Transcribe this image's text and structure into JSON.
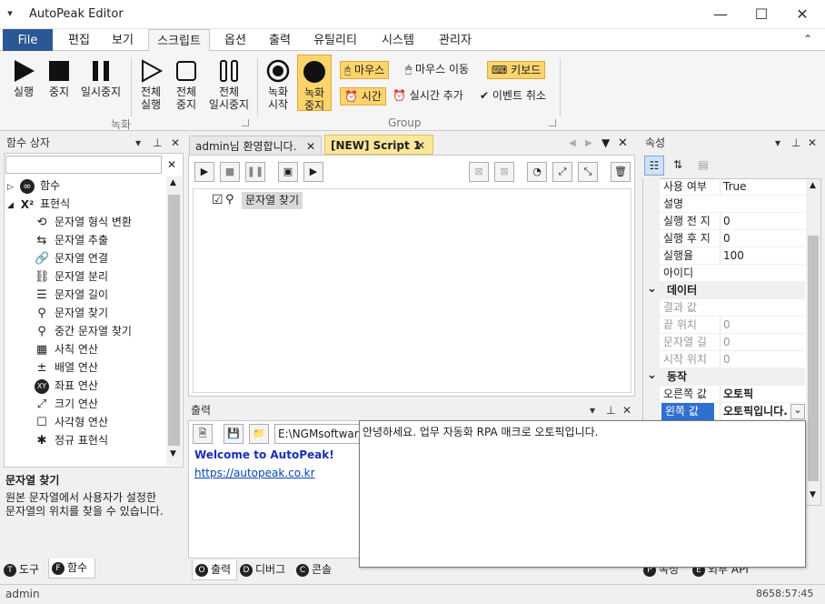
{
  "window": {
    "title": "AutoPeak Editor",
    "sysmenu_glyph": "▾",
    "min": "—",
    "max": "☐",
    "close": "✕"
  },
  "menu": {
    "file": "File",
    "tabs": [
      "편집",
      "보기",
      "스크립트",
      "옵션",
      "출력",
      "유틸리티",
      "시스템",
      "관리자"
    ],
    "active_tab": "스크립트",
    "collapse_glyph": "⌃"
  },
  "ribbon": {
    "record_group": {
      "label": "녹화",
      "buttons": [
        {
          "label_1": "실행",
          "label_2": "",
          "icon": "play-icon"
        },
        {
          "label_1": "중지",
          "label_2": "",
          "icon": "stop-icon"
        },
        {
          "label_1": "일시중지",
          "label_2": "",
          "icon": "pause-icon"
        },
        {
          "label_1": "전체",
          "label_2": "실행",
          "icon": "play-outline-icon"
        },
        {
          "label_1": "전체",
          "label_2": "중지",
          "icon": "stop-outline-icon"
        },
        {
          "label_1": "전체",
          "label_2": "일시중지",
          "icon": "pause-outline-icon"
        }
      ]
    },
    "group2": {
      "label": "Group",
      "rec_start": {
        "label_1": "녹화",
        "label_2": "시작"
      },
      "rec_stop": {
        "label_1": "녹화",
        "label_2": "중지"
      },
      "mouse": "마우스",
      "mouse_move": "마우스 이동",
      "keyboard": "키보드",
      "time": "시간",
      "realtime_add": "실시간 추가",
      "event_cancel": "이벤트 취소"
    }
  },
  "left_panel": {
    "title": "함수 상자",
    "search_value": "",
    "tree": [
      {
        "label": "함수",
        "icon": "infinity-icon",
        "glyph": "∞",
        "level": 0,
        "expander": "▷"
      },
      {
        "label": "표현식",
        "icon": "x-squared-icon",
        "glyph": "X²",
        "level": 0,
        "expander": "◢"
      },
      {
        "label": "문자열 형식 변환",
        "icon": "convert-icon",
        "glyph": "⟲",
        "level": 1
      },
      {
        "label": "문자열 추출",
        "icon": "extract-icon",
        "glyph": "⇆",
        "level": 1
      },
      {
        "label": "문자열 연결",
        "icon": "link-icon",
        "glyph": "🔗",
        "level": 1
      },
      {
        "label": "문자열 분리",
        "icon": "unlink-icon",
        "glyph": "⛓",
        "level": 1
      },
      {
        "label": "문자열 길이",
        "icon": "text-length-icon",
        "glyph": "☰",
        "level": 1
      },
      {
        "label": "문자열 찾기",
        "icon": "search-icon",
        "glyph": "⚲",
        "level": 1
      },
      {
        "label": "중간 문자열 찾기",
        "icon": "zoom-search-icon",
        "glyph": "⚲",
        "level": 1
      },
      {
        "label": "사칙 연산",
        "icon": "calculator-icon",
        "glyph": "▦",
        "level": 1
      },
      {
        "label": "배열 연산",
        "icon": "plus-minus-icon",
        "glyph": "±",
        "level": 1
      },
      {
        "label": "좌표 연산",
        "icon": "xy-icon",
        "glyph": "XY",
        "level": 1
      },
      {
        "label": "크기 연산",
        "icon": "resize-icon",
        "glyph": "⤢",
        "level": 1
      },
      {
        "label": "사각형 연산",
        "icon": "rectangle-icon",
        "glyph": "☐",
        "level": 1
      },
      {
        "label": "정규 표현식",
        "icon": "asterisk-icon",
        "glyph": "✱",
        "level": 1
      }
    ],
    "desc_title": "문자열 찾기",
    "desc_text_1": "원본 문자열에서 사용자가 설정한",
    "desc_text_2": "문자열의 위치를 찾을 수 있습니다.",
    "tabs": [
      {
        "letter": "T",
        "label": "도구"
      },
      {
        "letter": "F",
        "label": "함수"
      }
    ]
  },
  "doc": {
    "tabs": [
      {
        "label": "admin님 환영합니다."
      },
      {
        "label": "[NEW] Script 1"
      }
    ],
    "script_item": "문자열 찾기",
    "checkbox_glyph": "☑"
  },
  "output": {
    "title": "출력",
    "path": "E:\\NGMsoftware",
    "welcome": "Welcome to AutoPeak!",
    "url": "https://autopeak.co.kr",
    "tabs": [
      {
        "letter": "O",
        "label": "출력"
      },
      {
        "letter": "D",
        "label": "디버그"
      },
      {
        "letter": "C",
        "label": "콘솔"
      }
    ]
  },
  "properties": {
    "title": "속성",
    "rows": [
      {
        "name": "사용 여부",
        "value": "True",
        "muted": false
      },
      {
        "name": "설명",
        "value": "",
        "muted": false
      },
      {
        "name": "실행 전 지",
        "value": "0",
        "muted": false
      },
      {
        "name": "실행 후 지",
        "value": "0",
        "muted": false
      },
      {
        "name": "실행율",
        "value": "100",
        "muted": false
      },
      {
        "name": "아이디",
        "value": "",
        "muted": false
      }
    ],
    "cat_data": "데이터",
    "data_rows": [
      {
        "name": "결과 값",
        "value": ""
      },
      {
        "name": "끝 위치",
        "value": "0"
      },
      {
        "name": "문자열 길",
        "value": "0"
      },
      {
        "name": "시작 위치",
        "value": "0"
      }
    ],
    "cat_action": "동작",
    "action_rows": [
      {
        "name": "오른쪽 값",
        "value": "오토픽"
      },
      {
        "name": "왼쪽 값",
        "value": "오토픽입니다."
      }
    ],
    "tabs": [
      {
        "letter": "P",
        "label": "속성"
      },
      {
        "letter": "E",
        "label": "외부 API"
      }
    ]
  },
  "popup": {
    "text": "안녕하세요. 업무 자동화 RPA 매크로 오토픽입니다."
  },
  "status": {
    "user": "admin",
    "clock": "8658:57:45"
  }
}
